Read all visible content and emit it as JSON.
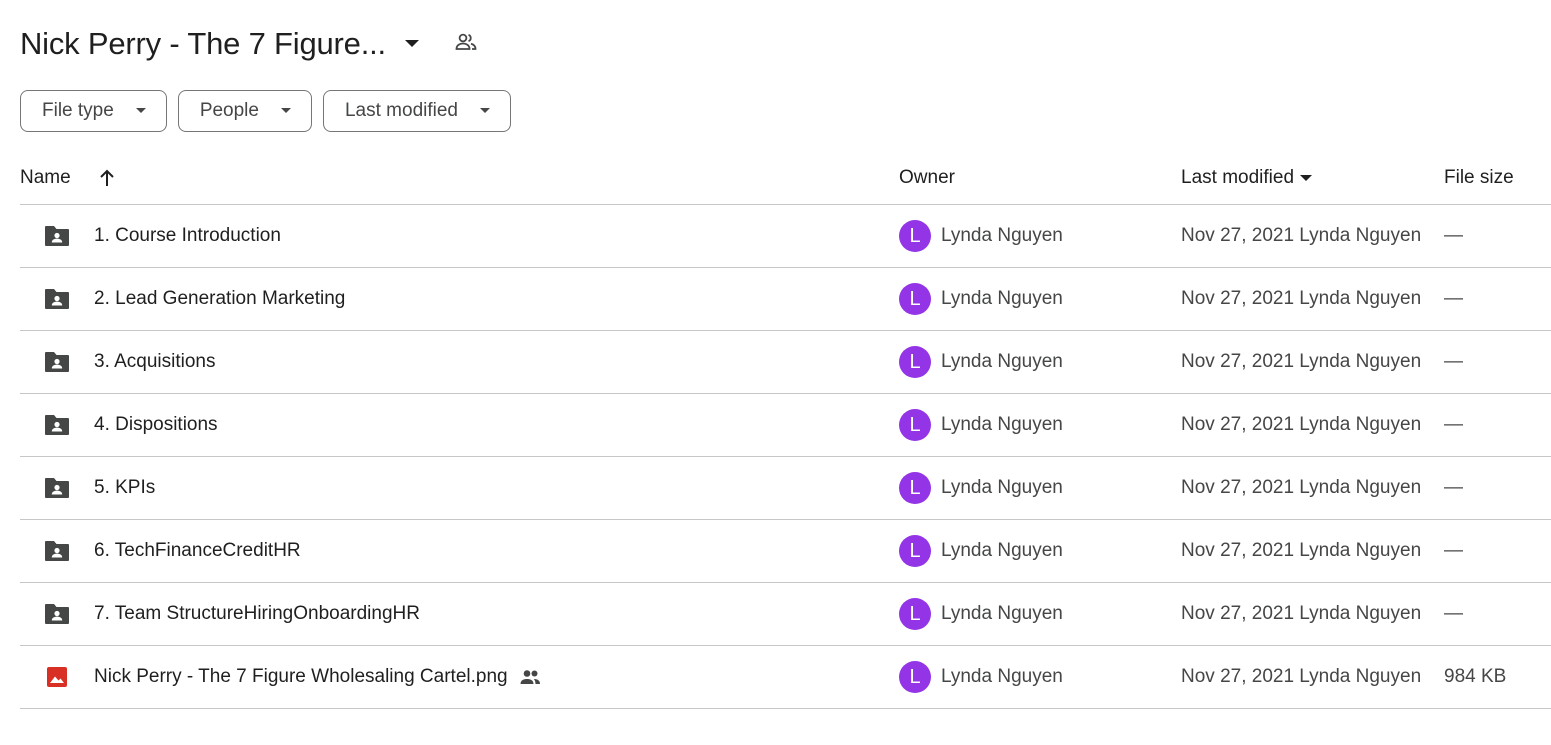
{
  "header": {
    "title": "Nick Perry - The 7 Figure...",
    "title_icon": "chevron-down-icon",
    "share_icon": "people-icon"
  },
  "filters": [
    {
      "label": "File type"
    },
    {
      "label": "People"
    },
    {
      "label": "Last modified"
    }
  ],
  "columns": {
    "name": "Name",
    "owner": "Owner",
    "last_modified": "Last modified",
    "file_size": "File size"
  },
  "colors": {
    "avatar": "#9334e6",
    "folder_icon": "#444746",
    "image_icon": "#d93025",
    "divider": "#c7c7c7"
  },
  "rows": [
    {
      "type": "shared-folder",
      "name": "1. Course Introduction",
      "owner_initial": "L",
      "owner": "Lynda Nguyen",
      "modified": "Nov 27, 2021 Lynda Nguyen",
      "size": "—"
    },
    {
      "type": "shared-folder",
      "name": "2. Lead Generation Marketing",
      "owner_initial": "L",
      "owner": "Lynda Nguyen",
      "modified": "Nov 27, 2021 Lynda Nguyen",
      "size": "—"
    },
    {
      "type": "shared-folder",
      "name": "3. Acquisitions",
      "owner_initial": "L",
      "owner": "Lynda Nguyen",
      "modified": "Nov 27, 2021 Lynda Nguyen",
      "size": "—"
    },
    {
      "type": "shared-folder",
      "name": "4. Dispositions",
      "owner_initial": "L",
      "owner": "Lynda Nguyen",
      "modified": "Nov 27, 2021 Lynda Nguyen",
      "size": "—"
    },
    {
      "type": "shared-folder",
      "name": "5. KPIs",
      "owner_initial": "L",
      "owner": "Lynda Nguyen",
      "modified": "Nov 27, 2021 Lynda Nguyen",
      "size": "—"
    },
    {
      "type": "shared-folder",
      "name": "6. TechFinanceCreditHR",
      "owner_initial": "L",
      "owner": "Lynda Nguyen",
      "modified": "Nov 27, 2021 Lynda Nguyen",
      "size": "—"
    },
    {
      "type": "shared-folder",
      "name": "7. Team StructureHiringOnboardingHR",
      "owner_initial": "L",
      "owner": "Lynda Nguyen",
      "modified": "Nov 27, 2021 Lynda Nguyen",
      "size": "—"
    },
    {
      "type": "image",
      "name": "Nick Perry - The 7 Figure Wholesaling Cartel.png",
      "shared": true,
      "owner_initial": "L",
      "owner": "Lynda Nguyen",
      "modified": "Nov 27, 2021 Lynda Nguyen",
      "size": "984 KB"
    }
  ]
}
